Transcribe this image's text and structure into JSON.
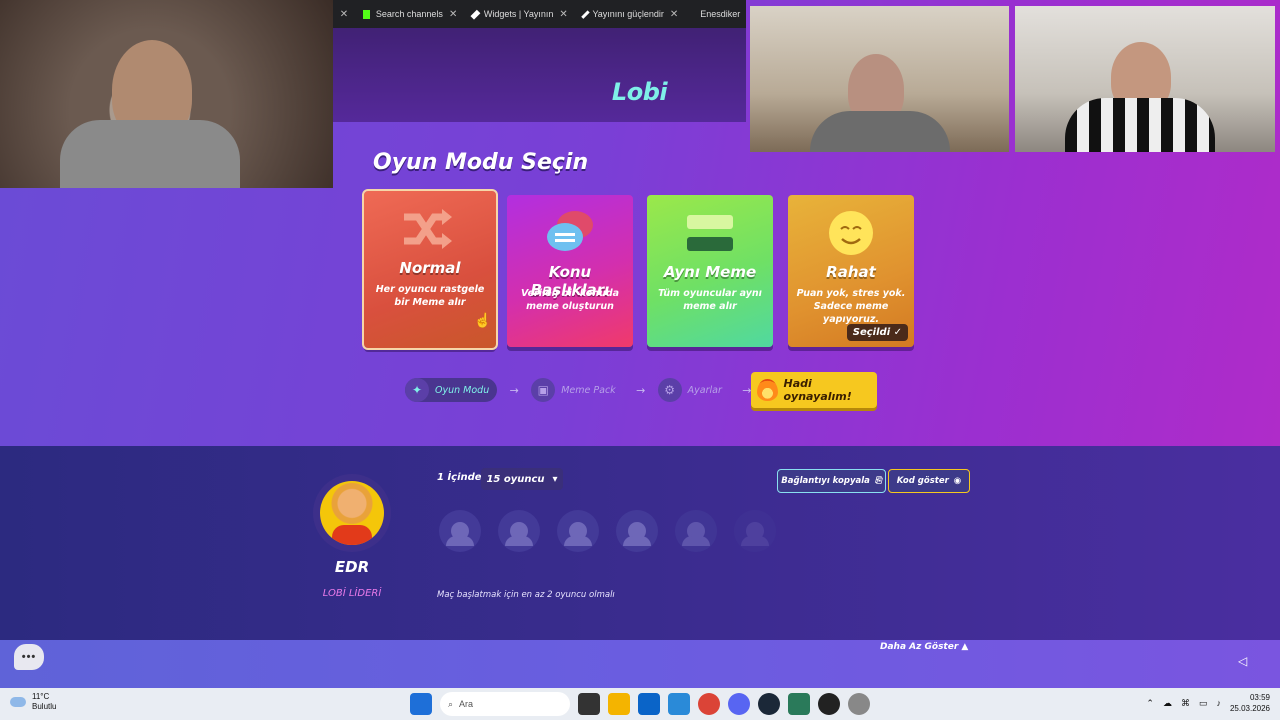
{
  "browser_tabs": [
    {
      "label": "Search channels"
    },
    {
      "label": "Widgets | Yayının"
    },
    {
      "label": "Yayınını güçlendir"
    },
    {
      "label": "Enesdiker"
    }
  ],
  "lobby_title": "Lobi",
  "mode_section_title": "Oyun Modu Seçin",
  "modes": [
    {
      "name": "Normal",
      "desc": "Her oyuncu rastgele bir Meme alır"
    },
    {
      "name": "Konu Başlıkları",
      "desc": "Verilen bir konuda meme oluşturun"
    },
    {
      "name": "Aynı Meme",
      "desc": "Tüm oyuncular aynı meme alır"
    },
    {
      "name": "Rahat",
      "desc": "Puan yok, stres yok. Sadece meme yapıyoruz.",
      "badge": "Seçildi"
    }
  ],
  "steps": [
    {
      "label": "Oyun Modu"
    },
    {
      "label": "Meme Pack"
    },
    {
      "label": "Ayarlar"
    }
  ],
  "play_button": "Hadi oynayalım!",
  "player": {
    "name": "EDR",
    "role": "LOBİ LİDERİ"
  },
  "player_count_label": "1 İçinden",
  "player_count_select": "15 oyuncu",
  "min_players_warning": "Maç başlatmak için en az 2 oyuncu olmalı",
  "copy_link_button": "Bağlantıyı kopyala",
  "show_code_button": "Kod göster",
  "show_less_button": "Daha Az Göster",
  "taskbar": {
    "weather_temp": "11°C",
    "weather_desc": "Bulutlu",
    "search_placeholder": "Ara",
    "time": "03:59",
    "date": "25.03.2026"
  }
}
